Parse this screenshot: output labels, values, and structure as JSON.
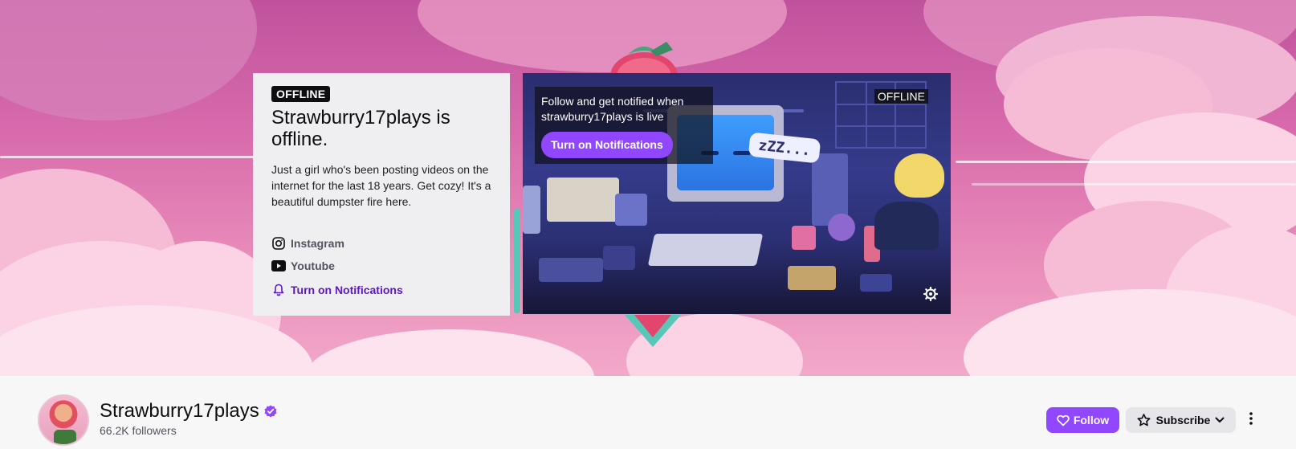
{
  "banner": {
    "info_card": {
      "status_badge": "OFFLINE",
      "title": "Strawburry17plays is offline.",
      "bio": "Just a girl who's been posting videos on the internet for the last 18 years. Get cozy! It's a beautiful dumpster fire here.",
      "social_links": [
        {
          "label": "Instagram",
          "icon": "instagram-icon"
        },
        {
          "label": "Youtube",
          "icon": "youtube-icon"
        }
      ],
      "notifications_label": "Turn on Notifications"
    },
    "player": {
      "tip_text": "Follow and get notified when strawburry17plays is live",
      "tip_button_label": "Turn on Notifications",
      "offline_tag": "OFFLINE",
      "zzz_text": "zZZ..."
    }
  },
  "channel": {
    "name": "Strawburry17plays",
    "verified": true,
    "followers": "66.2K followers",
    "follow_label": "Follow",
    "subscribe_label": "Subscribe"
  },
  "colors": {
    "accent": "#9147ff",
    "notif_link": "#5c16c5"
  }
}
